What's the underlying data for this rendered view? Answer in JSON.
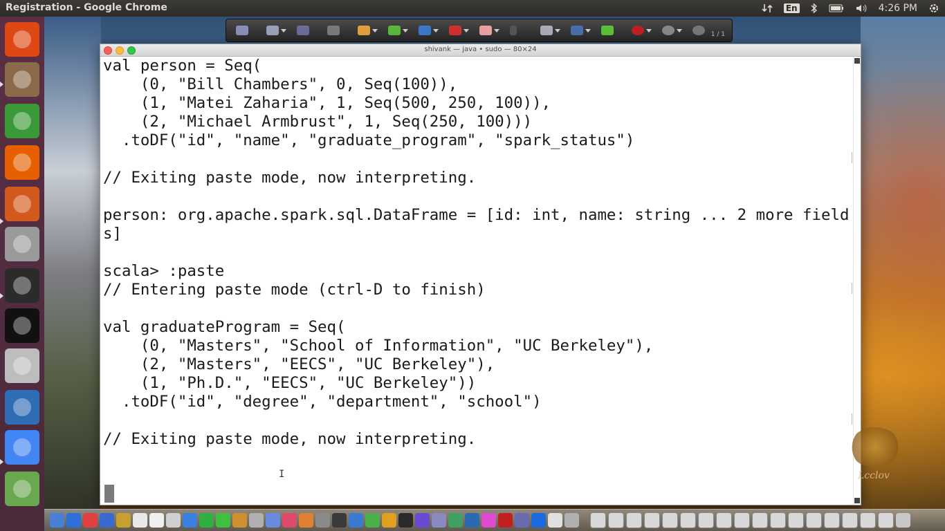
{
  "window_title": "Registration - Google Chrome",
  "top_panel": {
    "keyboard_layout": "En",
    "clock": "4:26 PM"
  },
  "draw_toolbar": {
    "page_indicator": "1 / 1"
  },
  "terminal": {
    "title": "shivank — java • sudo — 80×24",
    "lines": [
      "val person = Seq(",
      "    (0, \"Bill Chambers\", 0, Seq(100)),",
      "    (1, \"Matei Zaharia\", 1, Seq(500, 250, 100)),",
      "    (2, \"Michael Armbrust\", 1, Seq(250, 100)))",
      "  .toDF(\"id\", \"name\", \"graduate_program\", \"spark_status\")",
      "",
      "// Exiting paste mode, now interpreting.",
      "",
      "person: org.apache.spark.sql.DataFrame = [id: int, name: string ... 2 more field",
      "s]",
      "",
      "scala> :paste",
      "// Entering paste mode (ctrl-D to finish)",
      "",
      "val graduateProgram = Seq(",
      "    (0, \"Masters\", \"School of Information\", \"UC Berkeley\"),",
      "    (2, \"Masters\", \"EECS\", \"UC Berkeley\"),",
      "    (1, \"Ph.D.\", \"EECS\", \"UC Berkeley\"))",
      "  .toDF(\"id\", \"degree\", \"department\", \"school\")",
      "",
      "// Exiting paste mode, now interpreting.",
      ""
    ]
  },
  "launcher": {
    "items": [
      {
        "name": "ubuntu-logo-icon",
        "color": "#dd4814"
      },
      {
        "name": "files-icon",
        "color": "#8a6a4a"
      },
      {
        "name": "spreadsheet-icon",
        "color": "#3a9a3a"
      },
      {
        "name": "firefox-icon",
        "color": "#e66000"
      },
      {
        "name": "presentation-icon",
        "color": "#d35a1e"
      },
      {
        "name": "system-settings-icon",
        "color": "#9a9a9a"
      },
      {
        "name": "terminal-icon",
        "color": "#2b2b2b"
      },
      {
        "name": "intellij-icon",
        "color": "#111111"
      },
      {
        "name": "help-icon",
        "color": "#bdbdbd"
      },
      {
        "name": "text-editor-icon",
        "color": "#2f6eb5"
      },
      {
        "name": "chrome-icon",
        "color": "#4285f4"
      },
      {
        "name": "image-viewer-icon",
        "color": "#6aa84f"
      }
    ]
  },
  "watermark_text": "Lcclov"
}
